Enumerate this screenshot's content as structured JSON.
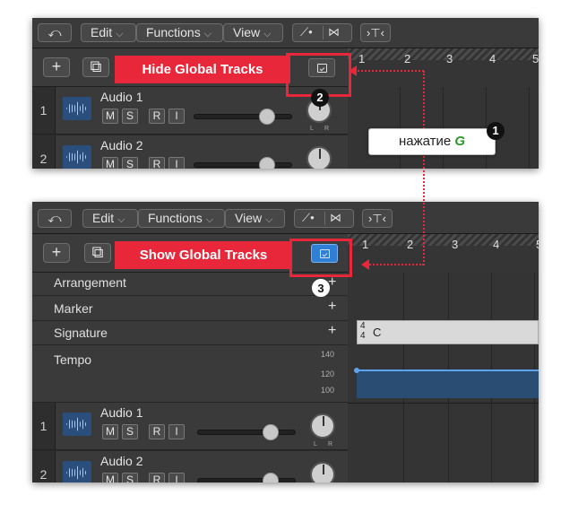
{
  "menubar": {
    "edit": "Edit",
    "functions": "Functions",
    "view": "View"
  },
  "top": {
    "label": "Hide Global Tracks",
    "ruler": [
      "1",
      "2",
      "3",
      "4",
      "5"
    ],
    "tracks": [
      {
        "num": "1",
        "name": "Audio 1",
        "buttons": [
          "M",
          "S",
          "R",
          "I"
        ]
      },
      {
        "num": "2",
        "name": "Audio 2",
        "buttons": [
          "M",
          "S",
          "R",
          "I"
        ]
      }
    ]
  },
  "bottom": {
    "label": "Show Global Tracks",
    "ruler": [
      "1",
      "2",
      "3",
      "4",
      "5"
    ],
    "global_tracks": [
      {
        "name": "Arrangement"
      },
      {
        "name": "Marker"
      },
      {
        "name": "Signature"
      },
      {
        "name": "Tempo"
      }
    ],
    "signature": {
      "top": "4",
      "bottom": "4",
      "key": "C"
    },
    "tempo_scale": [
      "140",
      "120",
      "100"
    ],
    "tracks": [
      {
        "num": "1",
        "name": "Audio 1",
        "buttons": [
          "M",
          "S",
          "R",
          "I"
        ]
      },
      {
        "num": "2",
        "name": "Audio 2",
        "buttons": [
          "M",
          "S",
          "R",
          "I"
        ]
      }
    ]
  },
  "pan_labels": {
    "left": "L",
    "right": "R"
  },
  "callout": {
    "text": "нажатие",
    "key": "G"
  },
  "badges": {
    "one": "1",
    "two": "2",
    "three": "3"
  },
  "colors": {
    "accent_red": "#e8283a",
    "active_blue": "#2f7fd6",
    "key_green": "#2a9a2a"
  }
}
